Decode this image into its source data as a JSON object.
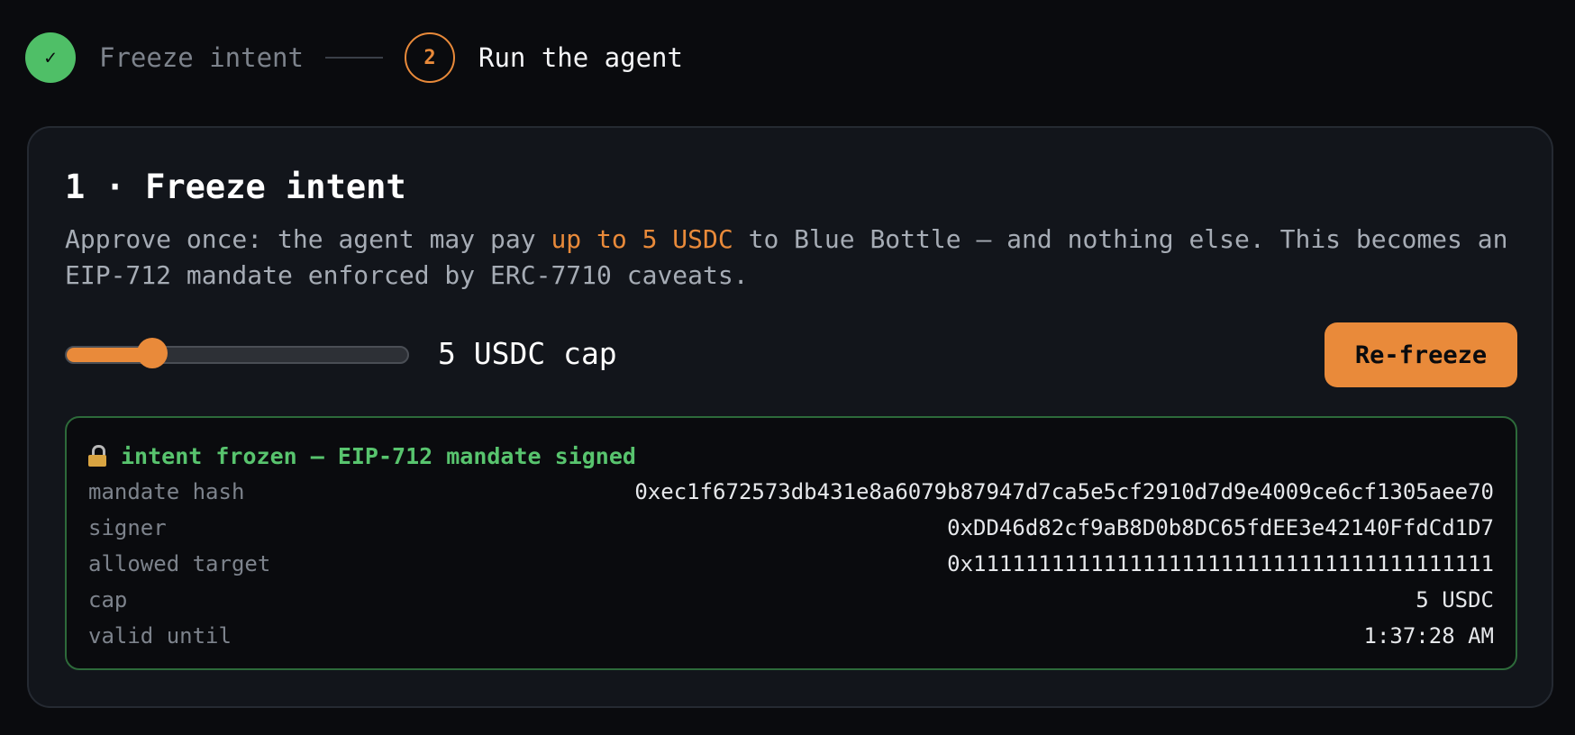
{
  "stepper": {
    "steps": [
      {
        "number": "✓",
        "label": "Freeze intent",
        "state": "done"
      },
      {
        "number": "2",
        "label": "Run the agent",
        "state": "active"
      }
    ]
  },
  "card": {
    "title": "1 · Freeze intent",
    "desc_before": "Approve once: the agent may pay ",
    "desc_highlight": "up to 5 USDC",
    "desc_after": " to Blue Bottle — and nothing else. This becomes an EIP-712 mandate enforced by ERC-7710 caveats.",
    "slider": {
      "value": 5,
      "min": 0,
      "max": 20,
      "label": "5 USDC cap"
    },
    "refreeze_label": "Re-freeze"
  },
  "mandate": {
    "header": "intent frozen — EIP-712 mandate signed",
    "icon": "lock-icon",
    "rows": [
      {
        "key": "mandate hash",
        "value": "0xec1f672573db431e8a6079b87947d7ca5e5cf2910d7d9e4009ce6cf1305aee70"
      },
      {
        "key": "signer",
        "value": "0xDD46d82cf9aB8D0b8DC65fdEE3e42140FfdCd1D7"
      },
      {
        "key": "allowed target",
        "value": "0x1111111111111111111111111111111111111111"
      },
      {
        "key": "cap",
        "value": "5 USDC"
      },
      {
        "key": "valid until",
        "value": "1:37:28 AM"
      }
    ]
  },
  "colors": {
    "accent": "#e98a3a",
    "success": "#4fbf67",
    "background": "#0a0b0e",
    "card": "#12151b"
  }
}
